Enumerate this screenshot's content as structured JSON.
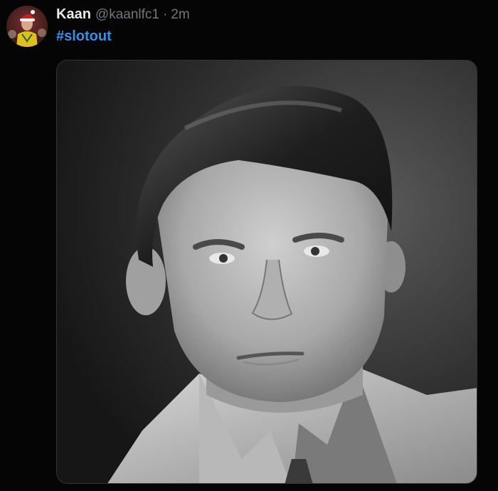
{
  "tweet": {
    "display_name": "Kaan",
    "handle": "@kaanlfc1",
    "separator": "·",
    "time": "2m",
    "text": "#slotout"
  },
  "avatar": {
    "icon": "profile-photo-avatar"
  },
  "media": {
    "description": "black-and-white portrait photo",
    "icon": "photo-image"
  },
  "colors": {
    "background": "#050505",
    "name": "#e7e9ea",
    "muted": "#71767b",
    "hashtag": "#3a8fe8",
    "border": "#2f3336"
  }
}
